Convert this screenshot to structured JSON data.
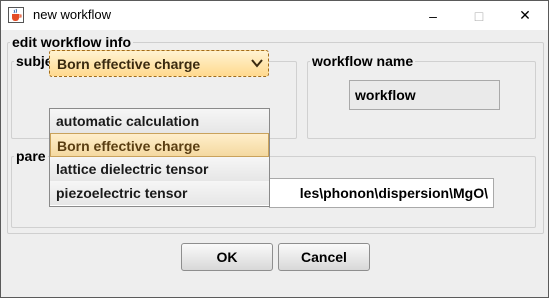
{
  "window": {
    "title": "new workflow",
    "minimize_label": "–",
    "maximize_label": "□",
    "close_label": "✕"
  },
  "groups": {
    "outer_label": "edit workflow info",
    "subject_label": "subject of workflow",
    "workflow_name_label": "workflow name",
    "parent_label": "pare"
  },
  "subject_combo": {
    "selected": "Born effective charge"
  },
  "dropdown": {
    "options": [
      "automatic calculation",
      "Born effective charge",
      "lattice dielectric tensor",
      "piezoelectric tensor"
    ],
    "highlighted_index": 1
  },
  "workflow_name": {
    "value": "workflow"
  },
  "parent_dir": {
    "value": "les\\phonon\\dispersion\\MgO\\"
  },
  "buttons": {
    "ok": "OK",
    "cancel": "Cancel"
  },
  "icons": {
    "app": "java-cup-icon",
    "combo_arrow": "chevron-down-icon"
  },
  "colors": {
    "selection": "#f4d9a0",
    "accent_border": "#a06b1a"
  }
}
